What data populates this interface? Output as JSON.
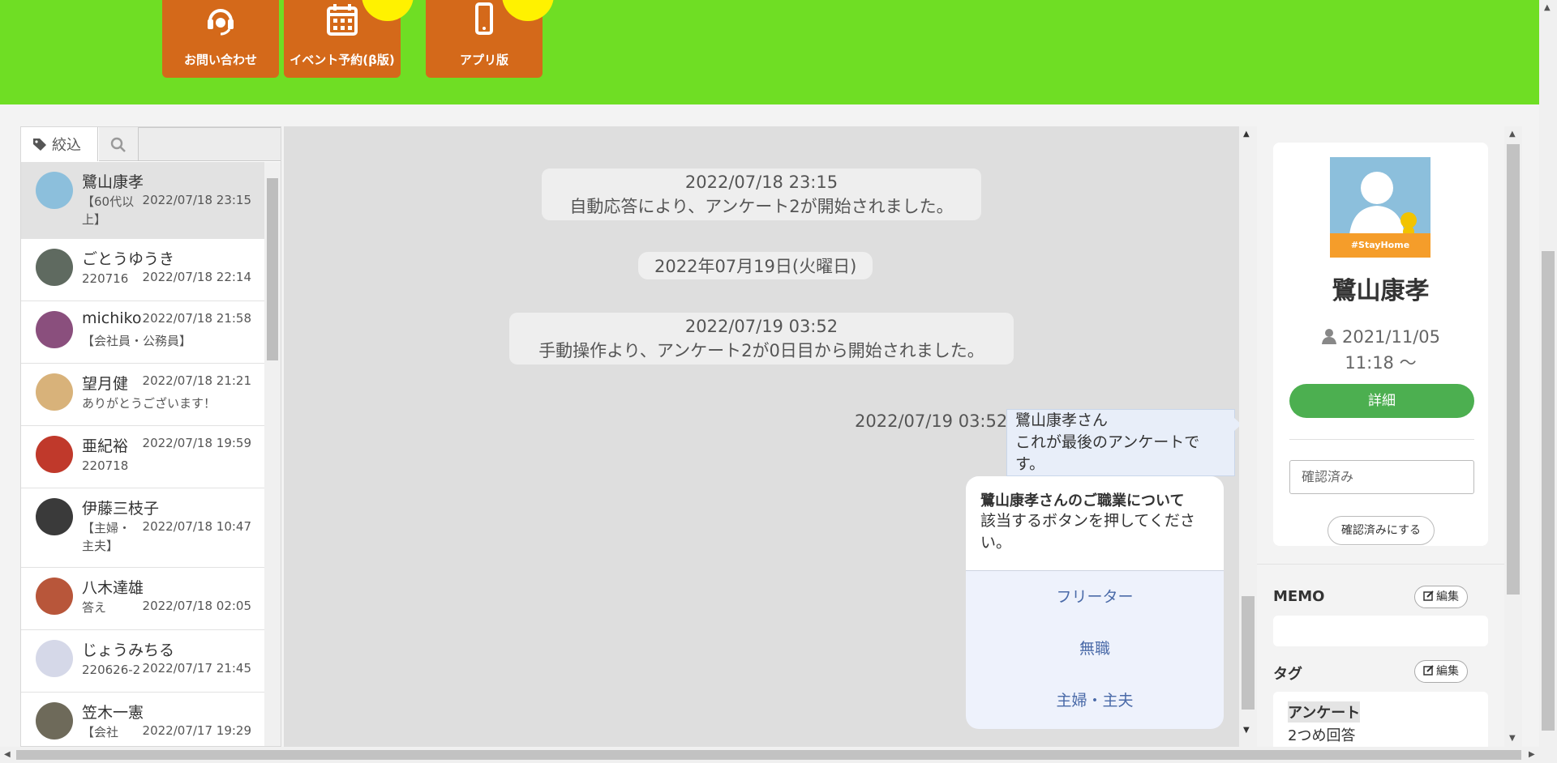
{
  "colors": {
    "header_bg": "#6fde24",
    "nav_button_bg": "#d4691a",
    "badge": "#fff200",
    "detail_button": "#4caf50",
    "chat_bg": "#dedede",
    "bubble_bg": "#e8eef9"
  },
  "nav": {
    "items": [
      {
        "label": "お問い合わせ",
        "icon": "headset-icon"
      },
      {
        "label": "イベント予約(β版)",
        "icon": "calendar-icon"
      },
      {
        "label": "アプリ版",
        "icon": "smartphone-icon"
      }
    ]
  },
  "sidebar": {
    "filter_label": "絞込",
    "search_value": "",
    "contacts": [
      {
        "name": "鷺山康孝",
        "sub": "【60代以上】",
        "time": "2022/07/18 23:15",
        "active": true
      },
      {
        "name": "ごとうゆうき",
        "sub": "220716",
        "time": "2022/07/18 22:14"
      },
      {
        "name": "michiko",
        "sub": "【会社員・公務員】",
        "time": "2022/07/18 21:58"
      },
      {
        "name": "望月健",
        "sub": "ありがとうございます！",
        "time": "2022/07/18 21:21"
      },
      {
        "name": "亜紀裕",
        "sub": "220718",
        "time": "2022/07/18 19:59"
      },
      {
        "name": "伊藤三枝子",
        "sub": "【主婦・主夫】",
        "time": "2022/07/18 10:47"
      },
      {
        "name": "八木達雄",
        "sub": "答え",
        "time": "2022/07/18 02:05"
      },
      {
        "name": "じょうみちる",
        "sub": "220626-2",
        "time": "2022/07/17 21:45"
      },
      {
        "name": "笠木一憲",
        "sub": "【会社",
        "time": "2022/07/17 19:29"
      }
    ]
  },
  "chat": {
    "system1": {
      "time": "2022/07/18 23:15",
      "text": "自動応答により、アンケート2が開始されました。"
    },
    "date_divider": "2022年07月19日(火曜日)",
    "system2": {
      "time": "2022/07/19 03:52",
      "text": "手動操作より、アンケート2が0日目から開始されました。"
    },
    "message": {
      "time": "2022/07/19 03:52",
      "line1": "鷺山康孝さん",
      "line2": "これが最後のアンケートです。"
    },
    "survey": {
      "title": "鷺山康孝さんのご職業について",
      "text": "該当するボタンを押してください。",
      "options": [
        "フリーター",
        "無職",
        "主婦・主夫"
      ]
    }
  },
  "profile": {
    "name": "鷺山康孝",
    "avatar_band": "#StayHome",
    "since_line1": "2021/11/05",
    "since_line2": "11:18 ～",
    "detail_button": "詳細",
    "status_value": "確認済み",
    "confirm_button": "確認済みにする",
    "memo_title": "MEMO",
    "tag_title": "タグ",
    "edit_label": "編集",
    "tag_name": "アンケート",
    "tag_value": "2つめ回答"
  }
}
